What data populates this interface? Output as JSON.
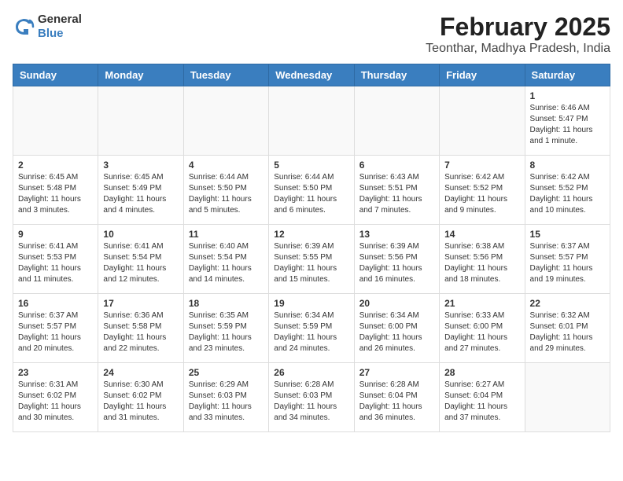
{
  "header": {
    "logo_line1": "General",
    "logo_line2": "Blue",
    "title": "February 2025",
    "subtitle": "Teonthar, Madhya Pradesh, India"
  },
  "days_of_week": [
    "Sunday",
    "Monday",
    "Tuesday",
    "Wednesday",
    "Thursday",
    "Friday",
    "Saturday"
  ],
  "weeks": [
    [
      {
        "day": "",
        "info": ""
      },
      {
        "day": "",
        "info": ""
      },
      {
        "day": "",
        "info": ""
      },
      {
        "day": "",
        "info": ""
      },
      {
        "day": "",
        "info": ""
      },
      {
        "day": "",
        "info": ""
      },
      {
        "day": "1",
        "info": "Sunrise: 6:46 AM\nSunset: 5:47 PM\nDaylight: 11 hours\nand 1 minute."
      }
    ],
    [
      {
        "day": "2",
        "info": "Sunrise: 6:45 AM\nSunset: 5:48 PM\nDaylight: 11 hours\nand 3 minutes."
      },
      {
        "day": "3",
        "info": "Sunrise: 6:45 AM\nSunset: 5:49 PM\nDaylight: 11 hours\nand 4 minutes."
      },
      {
        "day": "4",
        "info": "Sunrise: 6:44 AM\nSunset: 5:50 PM\nDaylight: 11 hours\nand 5 minutes."
      },
      {
        "day": "5",
        "info": "Sunrise: 6:44 AM\nSunset: 5:50 PM\nDaylight: 11 hours\nand 6 minutes."
      },
      {
        "day": "6",
        "info": "Sunrise: 6:43 AM\nSunset: 5:51 PM\nDaylight: 11 hours\nand 7 minutes."
      },
      {
        "day": "7",
        "info": "Sunrise: 6:42 AM\nSunset: 5:52 PM\nDaylight: 11 hours\nand 9 minutes."
      },
      {
        "day": "8",
        "info": "Sunrise: 6:42 AM\nSunset: 5:52 PM\nDaylight: 11 hours\nand 10 minutes."
      }
    ],
    [
      {
        "day": "9",
        "info": "Sunrise: 6:41 AM\nSunset: 5:53 PM\nDaylight: 11 hours\nand 11 minutes."
      },
      {
        "day": "10",
        "info": "Sunrise: 6:41 AM\nSunset: 5:54 PM\nDaylight: 11 hours\nand 12 minutes."
      },
      {
        "day": "11",
        "info": "Sunrise: 6:40 AM\nSunset: 5:54 PM\nDaylight: 11 hours\nand 14 minutes."
      },
      {
        "day": "12",
        "info": "Sunrise: 6:39 AM\nSunset: 5:55 PM\nDaylight: 11 hours\nand 15 minutes."
      },
      {
        "day": "13",
        "info": "Sunrise: 6:39 AM\nSunset: 5:56 PM\nDaylight: 11 hours\nand 16 minutes."
      },
      {
        "day": "14",
        "info": "Sunrise: 6:38 AM\nSunset: 5:56 PM\nDaylight: 11 hours\nand 18 minutes."
      },
      {
        "day": "15",
        "info": "Sunrise: 6:37 AM\nSunset: 5:57 PM\nDaylight: 11 hours\nand 19 minutes."
      }
    ],
    [
      {
        "day": "16",
        "info": "Sunrise: 6:37 AM\nSunset: 5:57 PM\nDaylight: 11 hours\nand 20 minutes."
      },
      {
        "day": "17",
        "info": "Sunrise: 6:36 AM\nSunset: 5:58 PM\nDaylight: 11 hours\nand 22 minutes."
      },
      {
        "day": "18",
        "info": "Sunrise: 6:35 AM\nSunset: 5:59 PM\nDaylight: 11 hours\nand 23 minutes."
      },
      {
        "day": "19",
        "info": "Sunrise: 6:34 AM\nSunset: 5:59 PM\nDaylight: 11 hours\nand 24 minutes."
      },
      {
        "day": "20",
        "info": "Sunrise: 6:34 AM\nSunset: 6:00 PM\nDaylight: 11 hours\nand 26 minutes."
      },
      {
        "day": "21",
        "info": "Sunrise: 6:33 AM\nSunset: 6:00 PM\nDaylight: 11 hours\nand 27 minutes."
      },
      {
        "day": "22",
        "info": "Sunrise: 6:32 AM\nSunset: 6:01 PM\nDaylight: 11 hours\nand 29 minutes."
      }
    ],
    [
      {
        "day": "23",
        "info": "Sunrise: 6:31 AM\nSunset: 6:02 PM\nDaylight: 11 hours\nand 30 minutes."
      },
      {
        "day": "24",
        "info": "Sunrise: 6:30 AM\nSunset: 6:02 PM\nDaylight: 11 hours\nand 31 minutes."
      },
      {
        "day": "25",
        "info": "Sunrise: 6:29 AM\nSunset: 6:03 PM\nDaylight: 11 hours\nand 33 minutes."
      },
      {
        "day": "26",
        "info": "Sunrise: 6:28 AM\nSunset: 6:03 PM\nDaylight: 11 hours\nand 34 minutes."
      },
      {
        "day": "27",
        "info": "Sunrise: 6:28 AM\nSunset: 6:04 PM\nDaylight: 11 hours\nand 36 minutes."
      },
      {
        "day": "28",
        "info": "Sunrise: 6:27 AM\nSunset: 6:04 PM\nDaylight: 11 hours\nand 37 minutes."
      },
      {
        "day": "",
        "info": ""
      }
    ]
  ]
}
